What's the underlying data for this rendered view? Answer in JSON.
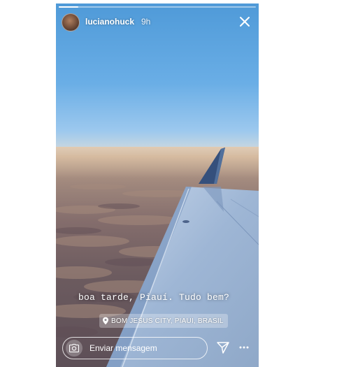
{
  "story": {
    "progress": 0.1,
    "username": "lucianohuck",
    "timestamp": "9h",
    "caption": "boa tarde, Piauí. Tudo bem?",
    "location": "BOM JESUS CITY, PIAUI, BRASIL"
  },
  "reply": {
    "placeholder": "Enviar mensagem"
  },
  "icons": {
    "avatar": "profile-photo",
    "close": "close-icon",
    "location": "location-pin-icon",
    "camera": "camera-icon",
    "send": "send-icon",
    "more": "more-options-icon"
  }
}
